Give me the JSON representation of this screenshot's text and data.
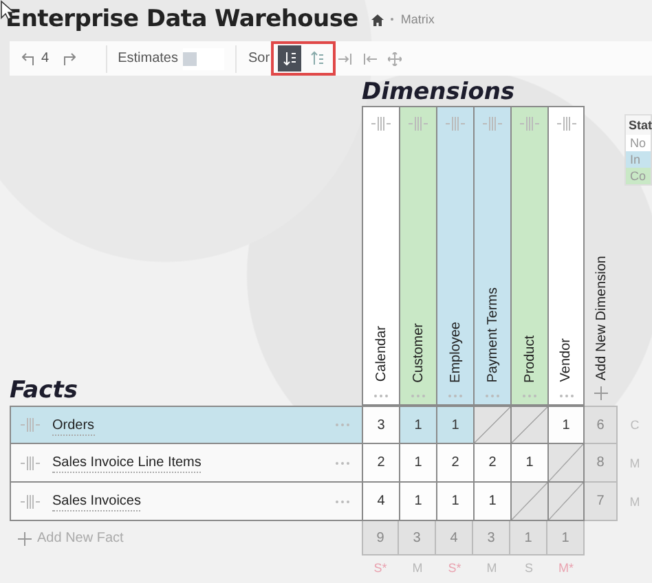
{
  "header": {
    "title": "Enterprise Data Warehouse",
    "breadcrumb": "Matrix"
  },
  "toolbar": {
    "undo_count": "4",
    "estimates_label": "Estimates",
    "estimates_checked": false,
    "sort_label": "Sor",
    "sort_buttons": [
      {
        "kind": "descending",
        "selected": true
      },
      {
        "kind": "ascending",
        "selected": false
      }
    ]
  },
  "dimensions": {
    "title": "Dimensions",
    "add_label": "Add New Dimension",
    "columns": [
      {
        "name": "Calendar",
        "color": "#ffffff"
      },
      {
        "name": "Customer",
        "color": "#c9e8c6"
      },
      {
        "name": "Employee",
        "color": "#c6e3ee"
      },
      {
        "name": "Payment Terms",
        "color": "#c6e3ee"
      },
      {
        "name": "Product",
        "color": "#c9e8c6"
      },
      {
        "name": "Vendor",
        "color": "#ffffff"
      }
    ],
    "totals": [
      {
        "value": "9",
        "mark": "S*",
        "color": "#e9a3b0"
      },
      {
        "value": "3",
        "mark": "M",
        "color": "#b8b8b8"
      },
      {
        "value": "4",
        "mark": "S*",
        "color": "#e9a3b0"
      },
      {
        "value": "3",
        "mark": "M",
        "color": "#b8b8b8"
      },
      {
        "value": "1",
        "mark": "S",
        "color": "#b8b8b8"
      },
      {
        "value": "1",
        "mark": "M*",
        "color": "#e9a3b0"
      }
    ]
  },
  "facts": {
    "title": "Facts",
    "add_label": "Add New Fact",
    "rows": [
      {
        "name": "Orders",
        "selected": true,
        "total": "6",
        "mark": "C",
        "cells": [
          {
            "kind": "count",
            "value": "3",
            "highlighted": false
          },
          {
            "kind": "count",
            "value": "1",
            "highlighted": true
          },
          {
            "kind": "count",
            "value": "1",
            "highlighted": true
          },
          {
            "kind": "hatched"
          },
          {
            "kind": "hatched"
          },
          {
            "kind": "count",
            "value": "1",
            "highlighted": false
          }
        ]
      },
      {
        "name": "Sales Invoice Line Items",
        "selected": false,
        "total": "8",
        "mark": "M",
        "cells": [
          {
            "kind": "count",
            "value": "2",
            "highlighted": false
          },
          {
            "kind": "count",
            "value": "1",
            "highlighted": false
          },
          {
            "kind": "count",
            "value": "2",
            "highlighted": false
          },
          {
            "kind": "count",
            "value": "2",
            "highlighted": false
          },
          {
            "kind": "count",
            "value": "1",
            "highlighted": false
          },
          {
            "kind": "hatched"
          }
        ]
      },
      {
        "name": "Sales Invoices",
        "selected": false,
        "total": "7",
        "mark": "M",
        "cells": [
          {
            "kind": "count",
            "value": "4",
            "highlighted": false
          },
          {
            "kind": "count",
            "value": "1",
            "highlighted": false
          },
          {
            "kind": "count",
            "value": "1",
            "highlighted": false
          },
          {
            "kind": "count",
            "value": "1",
            "highlighted": false
          },
          {
            "kind": "hatched"
          },
          {
            "kind": "hatched"
          }
        ]
      }
    ]
  },
  "legend": {
    "title": "Stat",
    "items": [
      {
        "label": "No",
        "color": "#ffffff"
      },
      {
        "label": "In",
        "color": "#c6e3ee"
      },
      {
        "label": "Co",
        "color": "#c9e8c6"
      }
    ]
  }
}
